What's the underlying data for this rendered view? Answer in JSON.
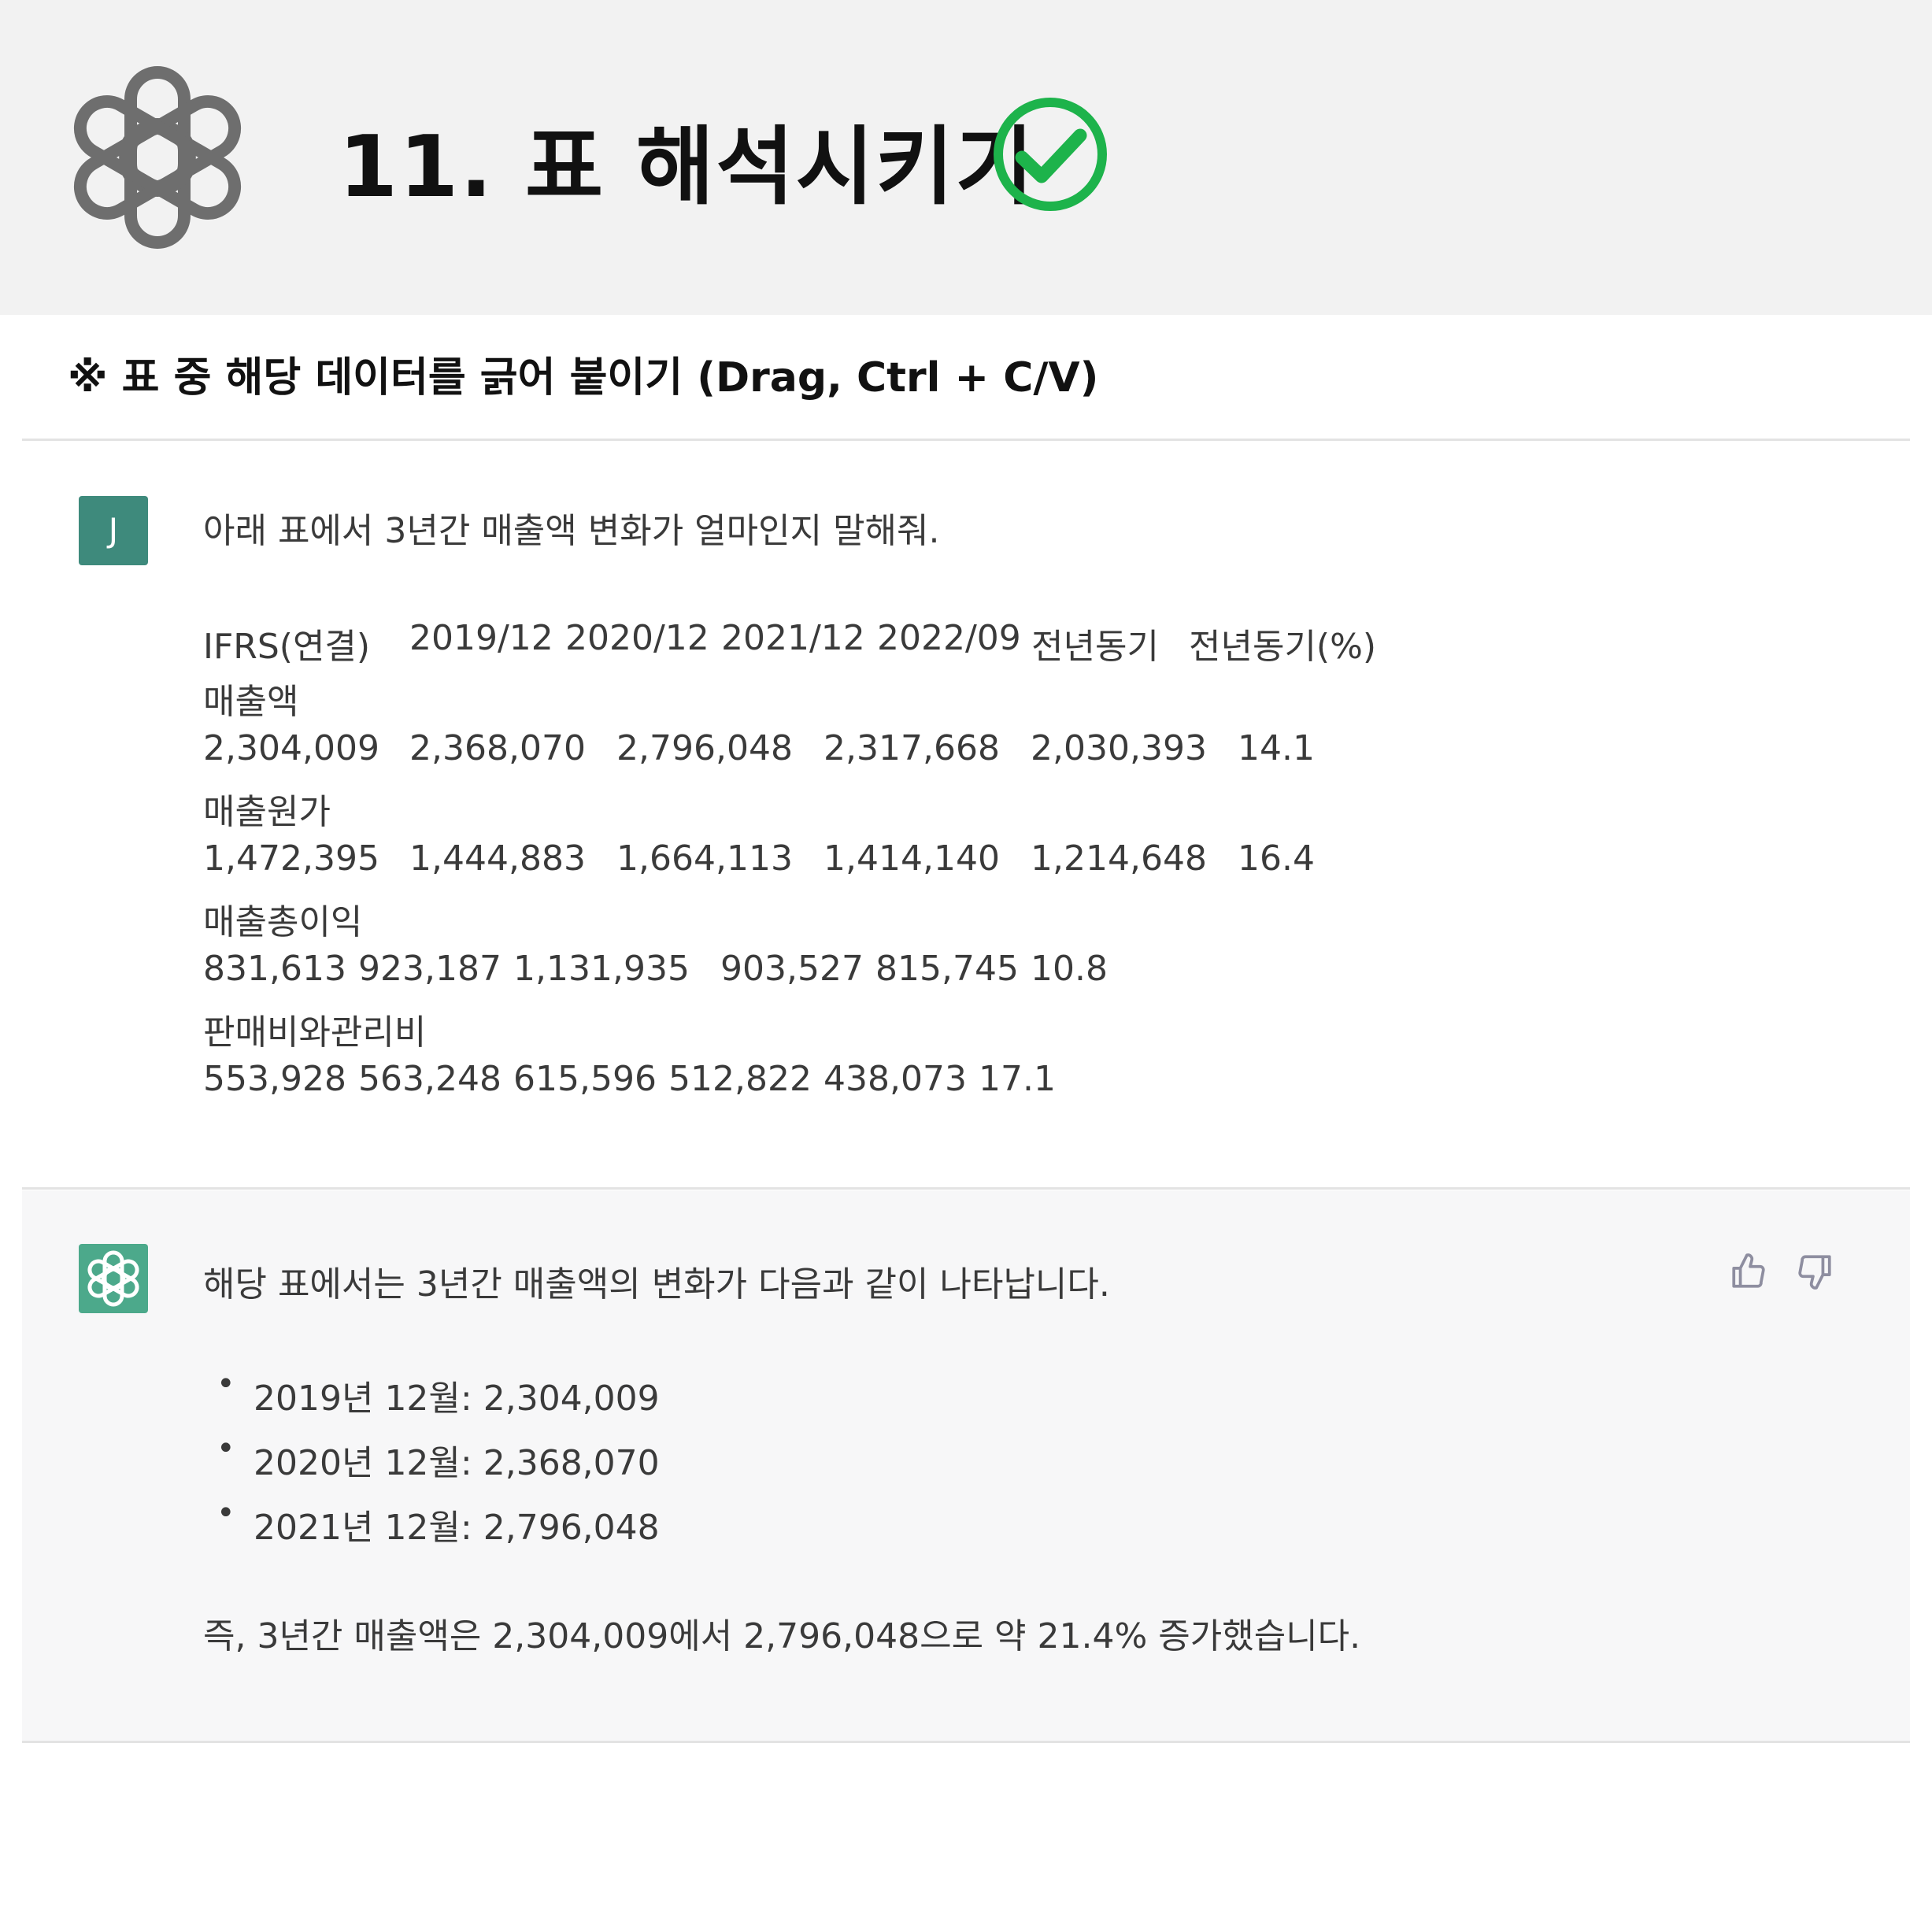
{
  "header": {
    "logo_icon": "openai-logo-icon",
    "title": "11. 표 해석시키기",
    "check_icon": "green-check-icon",
    "check_color": "#1db34b"
  },
  "subtitle": "※ 표 중 해당 데이터를 긁어 붙이기 (Drag, Ctrl + C/V)",
  "user_message": {
    "avatar_letter": "J",
    "avatar_color": "#3e8a7c",
    "prompt": "아래 표에서 3년간 매출액 변화가 얼마인지 말해줘.",
    "table_header": [
      "IFRS(연결)",
      "2019/12",
      "2020/12",
      "2021/12",
      "2022/09",
      "전년동기",
      "전년동기(%)"
    ],
    "rows": [
      {
        "label": "매출액",
        "values": [
          "2,304,009",
          "2,368,070",
          "2,796,048",
          "2,317,668",
          "2,030,393",
          "14.1"
        ]
      },
      {
        "label": "매출원가",
        "values": [
          "1,472,395",
          "1,444,883",
          "1,664,113",
          "1,414,140",
          "1,214,648",
          "16.4"
        ]
      },
      {
        "label": "매출총이익",
        "values": [
          "831,613",
          "923,187",
          "1,131,935",
          "903,527",
          "815,745",
          "10.8"
        ]
      },
      {
        "label": "판매비와관리비",
        "values": [
          "553,928",
          "563,248",
          "615,596",
          "512,822",
          "438,073",
          "17.1"
        ]
      }
    ]
  },
  "bot_message": {
    "avatar_icon": "openai-logo-icon",
    "avatar_color": "#4ca98b",
    "intro": "해당 표에서는 3년간 매출액의 변화가 다음과 같이 나타납니다.",
    "bullets": [
      "2019년 12월: 2,304,009",
      "2020년 12월: 2,368,070",
      "2021년 12월: 2,796,048"
    ],
    "conclusion": "즉, 3년간 매출액은 2,304,009에서 2,796,048으로 약 21.4% 증가했습니다.",
    "thumbs_up_icon": "thumbs-up-icon",
    "thumbs_down_icon": "thumbs-down-icon"
  }
}
